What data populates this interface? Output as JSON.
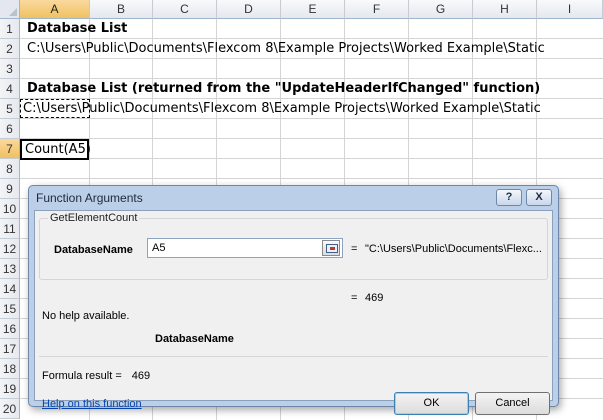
{
  "columns": [
    "A",
    "B",
    "C",
    "D",
    "E",
    "F",
    "G",
    "H",
    "I"
  ],
  "rows": [
    "1",
    "2",
    "3",
    "4",
    "5",
    "6",
    "7",
    "8",
    "9",
    "10",
    "11",
    "12",
    "13",
    "14",
    "15",
    "16",
    "17",
    "18",
    "19",
    "20"
  ],
  "cells": {
    "a1": "Database List",
    "a2": "C:\\Users\\Public\\Documents\\Flexcom 8\\Example Projects\\Worked Example\\Static",
    "a4": "Database List (returned from the \"UpdateHeaderIfChanged\" function)",
    "a5": "C:\\Users\\Public\\Documents\\Flexcom 8\\Example Projects\\Worked Example\\Static",
    "a7": "Count(A5)"
  },
  "dialog": {
    "title": "Function Arguments",
    "help_btn": "?",
    "close_btn": "X",
    "function_name": "GetElementCount",
    "arg_name": "DatabaseName",
    "arg_value": "A5",
    "arg_result": "\"C:\\Users\\Public\\Documents\\Flexc...",
    "equals": "=",
    "function_result": "469",
    "help_text": "No help available.",
    "arg_description_name": "DatabaseName",
    "formula_result_label": "Formula result =",
    "formula_result_value": "469",
    "help_link": "Help on this function",
    "ok_label": "OK",
    "cancel_label": "Cancel"
  }
}
